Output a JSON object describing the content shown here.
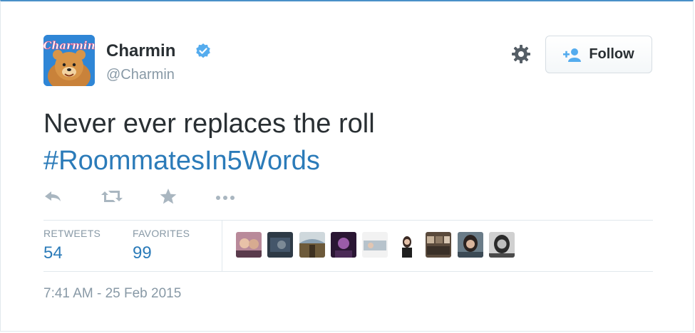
{
  "tweet": {
    "author": {
      "name": "Charmin",
      "handle": "@Charmin",
      "avatar_text": "Charmin",
      "verified_icon": "verified-badge-icon"
    },
    "follow_label": "Follow",
    "text_plain": "Never ever replaces the roll",
    "hashtag": "#RoommatesIn5Words",
    "stats": {
      "retweets_label": "RETWEETS",
      "retweets_value": "54",
      "favorites_label": "FAVORITES",
      "favorites_value": "99"
    },
    "timestamp": "7:41 AM - 25 Feb 2015",
    "actions": [
      "reply-icon",
      "retweet-icon",
      "favorite-star-icon",
      "more-icon"
    ],
    "favoriter_count_shown": 9
  },
  "colors": {
    "link": "#2b7bb9",
    "muted": "#8899a6",
    "text": "#292f33",
    "verified": "#55acee"
  }
}
